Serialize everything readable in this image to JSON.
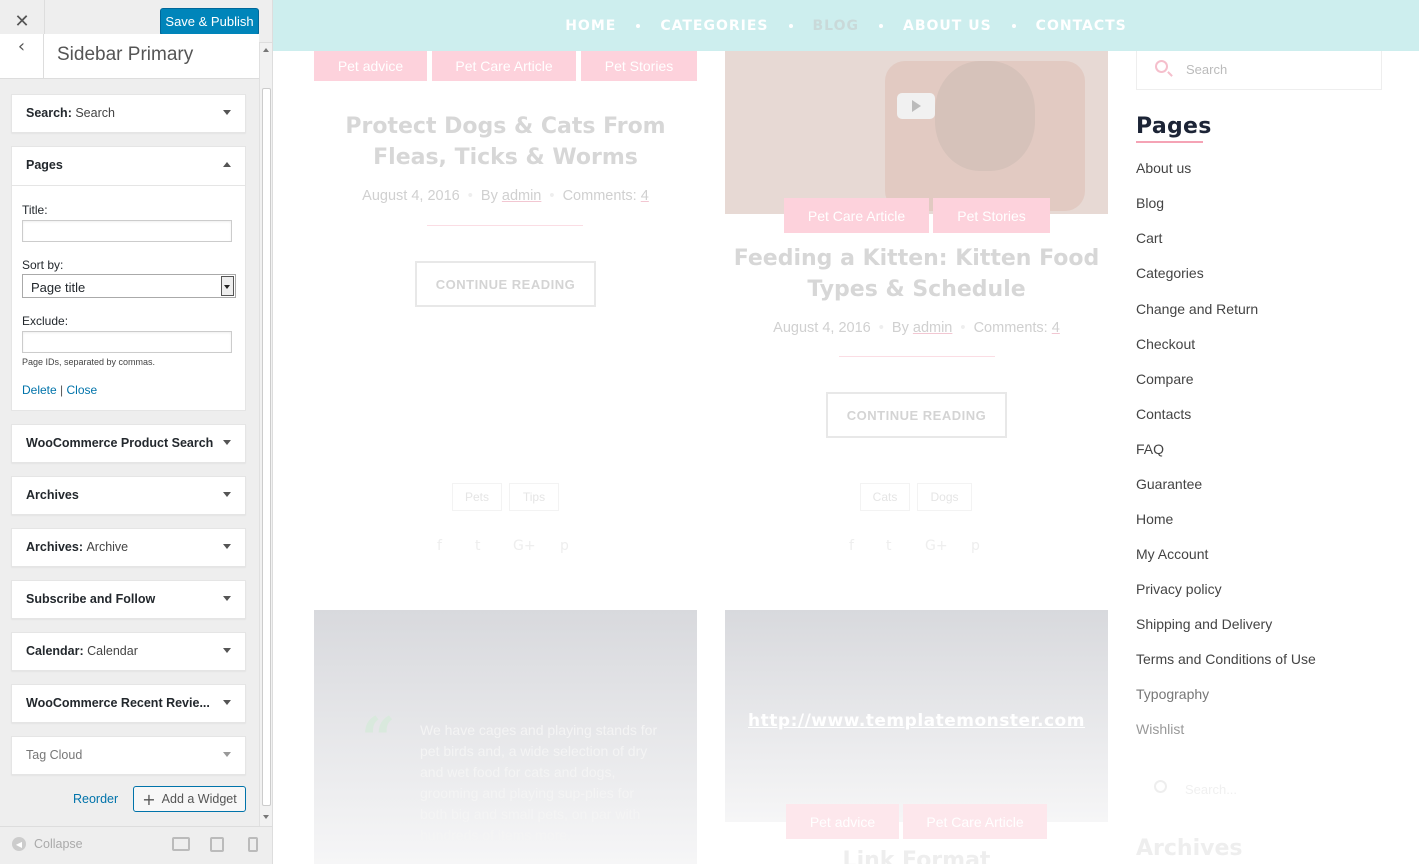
{
  "customizer": {
    "close_icon": "close-icon",
    "publish_label": "Save & Publish",
    "section_title": "Sidebar Primary",
    "widgets_top": [
      {
        "name": "Search",
        "sub": "Search"
      }
    ],
    "pages_widget": {
      "title": "Pages",
      "title_label": "Title:",
      "title_value": "",
      "sort_label": "Sort by:",
      "sort_value": "Page title",
      "exclude_label": "Exclude:",
      "exclude_value": "",
      "exclude_hint": "Page IDs, separated by commas.",
      "delete_label": "Delete",
      "separator": "|",
      "close_label": "Close"
    },
    "widgets_bottom": [
      {
        "name": "WooCommerce Product Search",
        "sub": ""
      },
      {
        "name": "Archives",
        "sub": ""
      },
      {
        "name": "Archives",
        "sub": "Archive"
      },
      {
        "name": "Subscribe and Follow",
        "sub": ""
      },
      {
        "name": "Calendar",
        "sub": "Calendar"
      },
      {
        "name": "WooCommerce Recent Revie...",
        "sub": ""
      },
      {
        "name": "Tag Cloud",
        "sub": ""
      }
    ],
    "reorder_label": "Reorder",
    "add_widget_label": "Add a Widget",
    "collapse_label": "Collapse"
  },
  "site": {
    "nav": [
      "HOME",
      "CATEGORIES",
      "BLOG",
      "ABOUT US",
      "CONTACTS"
    ],
    "nav_active": "BLOG",
    "posts": [
      {
        "tags": [
          "Pet advice",
          "Pet Care Article",
          "Pet Stories"
        ],
        "title": "Protect Dogs & Cats From Fleas, Ticks & Worms",
        "date": "August 4, 2016",
        "by": "By",
        "author": "admin",
        "comments_label": "Comments:",
        "comments": "4",
        "button": "CONTINUE READING",
        "chips": [
          "Pets",
          "Tips"
        ]
      },
      {
        "tags": [
          "Pet Care Article",
          "Pet Stories"
        ],
        "title": "Feeding a Kitten: Kitten Food Types & Schedule",
        "date": "August 4, 2016",
        "by": "By",
        "author": "admin",
        "comments_label": "Comments:",
        "comments": "4",
        "button": "CONTINUE READING",
        "chips": [
          "Cats",
          "Dogs"
        ]
      }
    ],
    "quote_text": "We have cages and playing stands for pet birds and, a wide selection of dry and wet food for cats and dogs, grooming and playing sup-plies for both big and small pets, on par with hundreds of items more.",
    "link_url": "http://www.templatemonster.com",
    "link_tags": [
      "Pet advice",
      "Pet Care Article"
    ],
    "link_title": "Link Format",
    "search_placeholder": "Search",
    "search_placeholder2": "Search...",
    "pages_heading": "Pages",
    "pages": [
      "About us",
      "Blog",
      "Cart",
      "Categories",
      "Change and Return",
      "Checkout",
      "Compare",
      "Contacts",
      "FAQ",
      "Guarantee",
      "Home",
      "My Account",
      "Privacy policy",
      "Shipping and Delivery",
      "Terms and Conditions of Use",
      "Typography",
      "Wishlist"
    ],
    "archives_heading": "Archives"
  }
}
